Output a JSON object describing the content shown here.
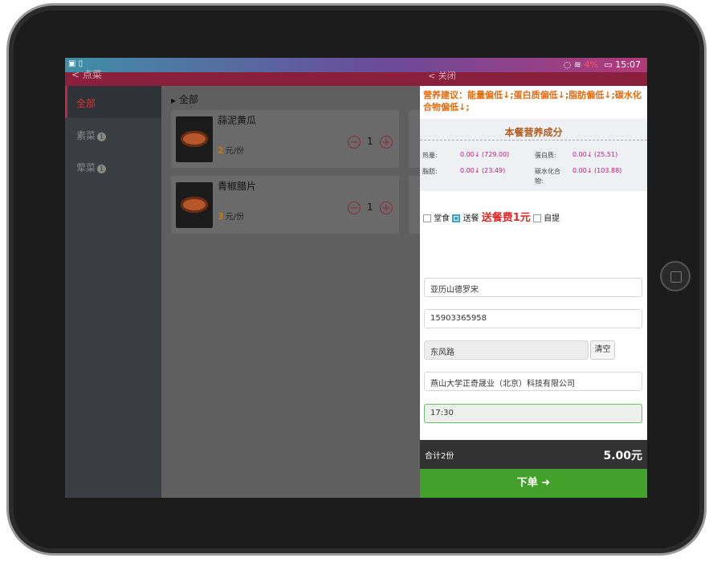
{
  "status_bar": {
    "left_icons": "▣ ▯",
    "battery_percent": "4%",
    "time": "15:07"
  },
  "app_bar": {
    "back_label": "< 点菜",
    "panel_back_label": "< 关闭"
  },
  "sidebar": {
    "items": [
      {
        "label": "全部",
        "badge": "",
        "active": true
      },
      {
        "label": "素菜",
        "badge": "1",
        "active": false
      },
      {
        "label": "荤菜",
        "badge": "1",
        "active": false
      }
    ]
  },
  "content": {
    "breadcrumb": "全部",
    "dishes": [
      {
        "name": "蒜泥黄瓜",
        "price": "2",
        "unit": "元/份",
        "qty": "1"
      },
      {
        "name": "青椒腊片",
        "price": "3",
        "unit": "元/份",
        "qty": "1"
      }
    ]
  },
  "panel": {
    "advice": "营养建议：能量偏低↓;蛋白质偏低↓;脂肪偏低↓;碳水化合物偏低↓;",
    "nutrition_title": "本餐营养成分",
    "nutrition": [
      {
        "label": "热量:",
        "value": "0.00↓ (729.00)"
      },
      {
        "label": "蛋白质:",
        "value": "0.00↓ (25.51)"
      },
      {
        "label": "脂肪:",
        "value": "0.00↓ (23.49)"
      },
      {
        "label": "碳水化合物:",
        "value": "0.00↓ (103.88)"
      }
    ],
    "delivery": {
      "dine_in": "堂食",
      "delivery": "送餐",
      "fee": "送餐费1元",
      "pickup": "自提",
      "selected": "delivery"
    },
    "form": {
      "name": "亚历山德罗宋",
      "phone": "15903365958",
      "road": "东风路",
      "clear_label": "清空",
      "company": "燕山大学正奇晟业（北京）科技有限公司",
      "time": "17:30"
    }
  },
  "footer": {
    "total_label": "合计2份",
    "total_amount": "5.00元",
    "order_label": "下单 ➜"
  },
  "colors": {
    "accent": "#8a1f3b",
    "order_green": "#43a02a",
    "advice_orange": "#e56a0c"
  }
}
